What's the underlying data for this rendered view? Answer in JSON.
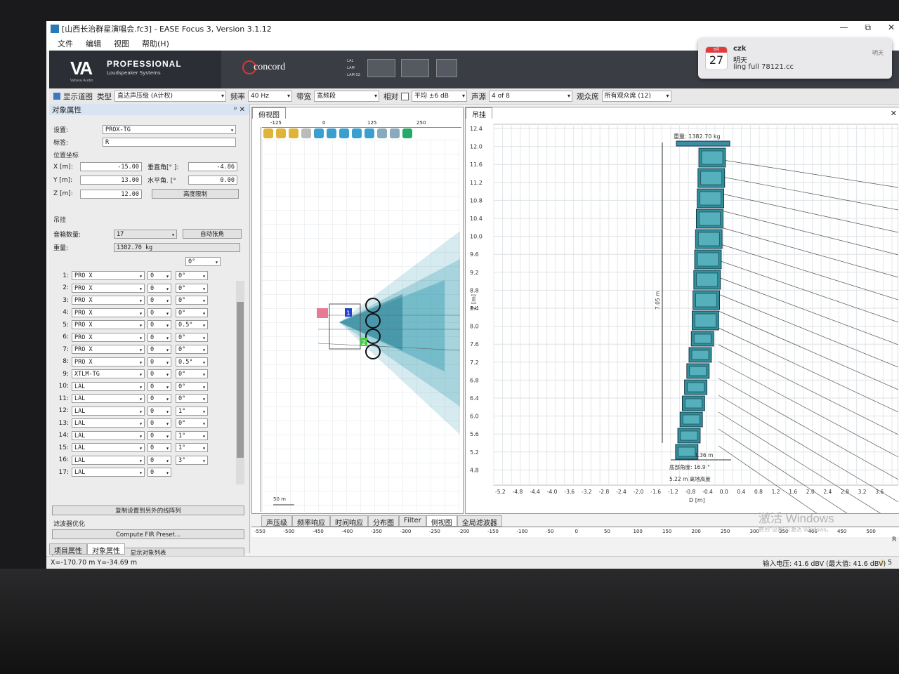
{
  "window": {
    "title": "[山西长治群星演唱会.fc3] - EASE Focus 3, Version 3.1.12",
    "minimize": "—",
    "restore": "⧉",
    "close": "✕"
  },
  "menu": [
    "文件",
    "编辑",
    "视图",
    "帮助(H)"
  ],
  "banner": {
    "va": "VA",
    "va_sub": "Vatasa Audio",
    "professional": "PROFESSIONAL",
    "professional_sub": "Loudspeaker Systems",
    "concord": "concord",
    "lal_list": [
      "· LAL",
      "· LAM",
      "· LAM-S2"
    ]
  },
  "toolbar": {
    "display_button": "显示道图",
    "type_label": "类型",
    "type_value": "直达声压级 (A计权)",
    "freq_label": "频率",
    "freq_value": "40 Hz",
    "band_label": "带宽",
    "band_value": "宽频段",
    "rel_label": "相对",
    "avg_value": "平均 ±6 dB",
    "source_label": "声源",
    "source_value": "4 of 8",
    "audience_label": "观众席",
    "audience_value": "所有观众席 (12)"
  },
  "left": {
    "title": "对象属性",
    "pin": "ᵖ",
    "close": "✕",
    "setting_label": "设置:",
    "setting_value": "PROX-TG",
    "tag_label": "标签:",
    "tag_value": "R",
    "pos_title": "位置坐标",
    "x_label": "X [m]:",
    "x_value": "-15.00",
    "y_label": "Y [m]:",
    "y_value": "13.00",
    "z_label": "Z [m]:",
    "z_value": "12.00",
    "vert_label": "垂直角[° ]:",
    "vert_value": "-4.86",
    "horiz_label": "水平角. [°",
    "horiz_value": "0.00",
    "height_limit": "高度限制",
    "hang_title": "吊挂",
    "count_label": "音箱数量:",
    "count_value": "17",
    "auto_splay": "自动张角",
    "weight_label": "重量:",
    "weight_value": "1382.70 kg",
    "top_splay": "0°",
    "rows": [
      {
        "n": "1:",
        "m": "PRO X",
        "a": "0",
        "b": "0°"
      },
      {
        "n": "2:",
        "m": "PRO X",
        "a": "0",
        "b": "0°"
      },
      {
        "n": "3:",
        "m": "PRO X",
        "a": "0",
        "b": "0°"
      },
      {
        "n": "4:",
        "m": "PRO X",
        "a": "0",
        "b": "0°"
      },
      {
        "n": "5:",
        "m": "PRO X",
        "a": "0",
        "b": "0.5°"
      },
      {
        "n": "6:",
        "m": "PRO X",
        "a": "0",
        "b": "0°"
      },
      {
        "n": "7:",
        "m": "PRO X",
        "a": "0",
        "b": "0°"
      },
      {
        "n": "8:",
        "m": "PRO X",
        "a": "0",
        "b": "0.5°"
      },
      {
        "n": "9:",
        "m": "XTLM-TG",
        "a": "0",
        "b": "0°"
      },
      {
        "n": "10:",
        "m": "LAL",
        "a": "0",
        "b": "0°"
      },
      {
        "n": "11:",
        "m": "LAL",
        "a": "0",
        "b": "0°"
      },
      {
        "n": "12:",
        "m": "LAL",
        "a": "0",
        "b": "1°"
      },
      {
        "n": "13:",
        "m": "LAL",
        "a": "0",
        "b": "0°"
      },
      {
        "n": "14:",
        "m": "LAL",
        "a": "0",
        "b": "1°"
      },
      {
        "n": "15:",
        "m": "LAL",
        "a": "0",
        "b": "1°"
      },
      {
        "n": "16:",
        "m": "LAL",
        "a": "0",
        "b": "3°"
      },
      {
        "n": "17:",
        "m": "LAL",
        "a": "0",
        "b": ""
      }
    ],
    "copy_btn": "复制设置到另外的线阵列",
    "filter_title": "滤波器优化",
    "fir_btn": "Compute FIR Preset...",
    "list_btn": "显示对象列表",
    "tab_project": "项目属性",
    "tab_object": "对象属性"
  },
  "mid": {
    "tab": "俯视图",
    "ruler_top": [
      "-125",
      "0",
      "125",
      "250"
    ],
    "ruler_left": [
      "375",
      "250",
      "125",
      "0",
      "-125",
      "-250",
      "-375"
    ],
    "scale": "50 m",
    "marker1": "1",
    "marker2": "2"
  },
  "right": {
    "tab": "吊挂",
    "close": "✕",
    "yticks": [
      "12.4",
      "12.0",
      "11.6",
      "11.2",
      "10.8",
      "10.4",
      "10.0",
      "9.6",
      "9.2",
      "8.8",
      "8.4",
      "8.0",
      "7.6",
      "7.2",
      "6.8",
      "6.4",
      "6.0",
      "5.6",
      "5.2",
      "4.8"
    ],
    "xticks": [
      "-5.2",
      "-4.8",
      "-4.4",
      "-4.0",
      "-3.6",
      "-3.2",
      "-2.8",
      "-2.4",
      "-2.0",
      "-1.6",
      "-1.2",
      "-0.8",
      "-0.4",
      "0.0",
      "0.4",
      "0.8",
      "1.2",
      "1.6",
      "2.0",
      "2.4",
      "2.8",
      "3.2",
      "3.6"
    ],
    "ylabel": "Z [m]",
    "xlabel": "D [m]",
    "weight": "重量: 1382.70 kg",
    "height_dim": "7.05 m",
    "width_dim": "1.36 m",
    "bottom_angle": "底部角度: 16.9 °",
    "floor_height": "5.22 m 离地高度"
  },
  "bottom_tabs": [
    "声压级",
    "频率响应",
    "时间响应",
    "分布图",
    "Filter",
    "侧视图",
    "全局滤波器"
  ],
  "bottom_active": "侧视图",
  "hruler": [
    "-550",
    "-500",
    "-450",
    "-400",
    "-350",
    "-300",
    "-250",
    "-200",
    "-150",
    "-100",
    "-50",
    "0",
    "50",
    "100",
    "150",
    "200",
    "250",
    "300",
    "350",
    "400",
    "450",
    "500"
  ],
  "hruler_r": "R",
  "status": {
    "coords": "X=-170.70 m Y=-34.69 m",
    "voltage": "输入电压: 41.6 dBV (最大值: 41.6 dBV)",
    "warn_count": "5"
  },
  "notification": {
    "month": "8月",
    "day": "27",
    "app": "czk",
    "title": "明天",
    "body": "ling full 78121.cc",
    "time": "明天"
  },
  "watermark": "激活 Windows",
  "watermark_sub": "转到\"设置\"以激活 Windows。",
  "colors": {
    "accent": "#2a7ab8",
    "speaker": "#2f8f9a",
    "coverage": "#1b8fa6"
  }
}
